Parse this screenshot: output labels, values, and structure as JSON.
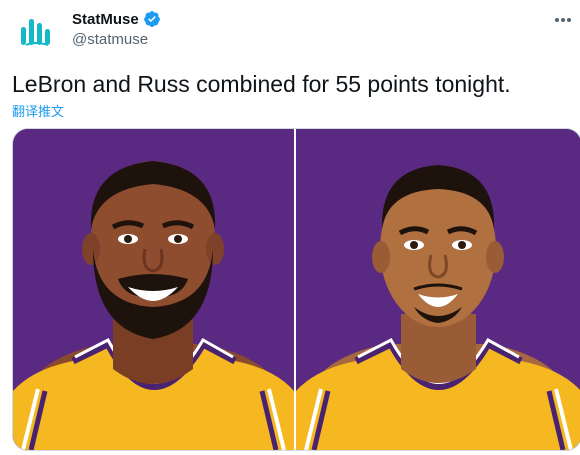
{
  "account": {
    "display_name": "StatMuse",
    "handle": "@statmuse",
    "verified": true,
    "avatar_icon": "statmuse-logo-icon",
    "logo_color": "#14b8c8"
  },
  "tweet": {
    "text": "LeBron and Russ combined for 55 points tonight.",
    "translate_label": "翻译推文"
  },
  "media": {
    "photos": [
      {
        "icon": "lebron-illustration"
      },
      {
        "icon": "russ-illustration"
      }
    ],
    "background_color": "#5a2a82",
    "jersey_color": "#f5b820"
  },
  "icons": {
    "verified": "verified-badge-icon",
    "more": "more-options-icon"
  },
  "colors": {
    "link": "#1d9bf0",
    "secondary_text": "#536471",
    "verified": "#1d9bf0"
  }
}
